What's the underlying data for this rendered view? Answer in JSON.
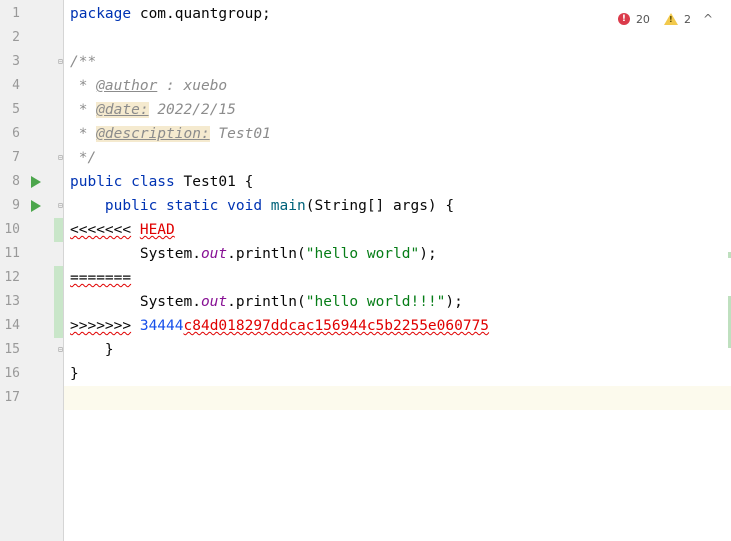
{
  "inspections": {
    "errors": "20",
    "warnings": "2",
    "collapse": "^"
  },
  "line_numbers": [
    "1",
    "2",
    "3",
    "4",
    "5",
    "6",
    "7",
    "8",
    "9",
    "10",
    "11",
    "12",
    "13",
    "14",
    "15",
    "16",
    "17"
  ],
  "code": {
    "l1_kw": "package",
    "l1_rest": " com.quantgroup;",
    "l3": "/**",
    "l4_pre": " * ",
    "l4_tag": "@author",
    "l4_rest": " : xuebo",
    "l5_pre": " * ",
    "l5_tag": "@date:",
    "l5_rest": " 2022/2/15",
    "l6_pre": " * ",
    "l6_tag": "@description:",
    "l6_rest": " Test01",
    "l7": " */",
    "l8_kw": "public class",
    "l8_rest": " Test01 {",
    "l9_indent": "    ",
    "l9_kw": "public static void",
    "l9_sp": " ",
    "l9_fn": "main",
    "l9_rest": "(String[] args) {",
    "l10_marker": "<<<<<<<",
    "l10_sp": " ",
    "l10_head": "HEAD",
    "l11_indent": "        ",
    "l11_obj": "System.",
    "l11_field": "out",
    "l11_call": ".println(",
    "l11_str": "\"hello world\"",
    "l11_end": ");",
    "l12_marker": "=======",
    "l13_indent": "        ",
    "l13_obj": "System.",
    "l13_field": "out",
    "l13_call": ".println(",
    "l13_str": "\"hello world!!!\"",
    "l13_end": ");",
    "l14_marker": ">>>>>>>",
    "l14_sp": " ",
    "l14_hash_a": "34444",
    "l14_hash_b": "c84d018297ddcac156944c5b2255e060775",
    "l15": "    }",
    "l16": "}"
  },
  "colors": {
    "keyword": "#0033b3",
    "string": "#067d17",
    "error": "#e00000",
    "doc": "#8c8c8c"
  }
}
